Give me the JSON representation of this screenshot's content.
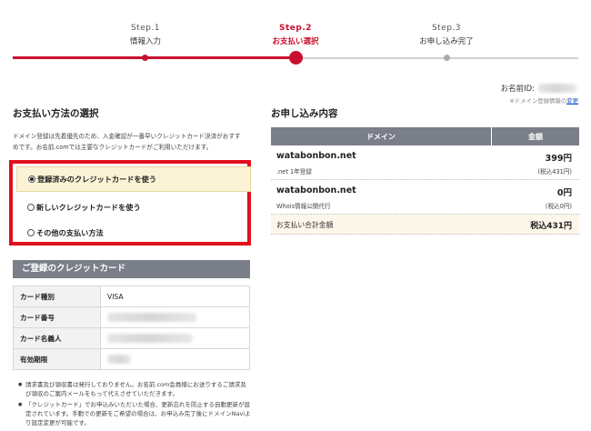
{
  "steps": [
    {
      "num": "Step.1",
      "label": "情報入力"
    },
    {
      "num": "Step.2",
      "label": "お支払い選択"
    },
    {
      "num": "Step.3",
      "label": "お申し込み完了"
    }
  ],
  "colors": {
    "accent": "#c8102e",
    "highlight_box": "#e0101c",
    "header_gray": "#7a7f89"
  },
  "payment": {
    "title": "お支払い方法の選択",
    "note_line1": "ドメイン登録は先着優先のため、入金確認が一番早いクレジットカード決済がおすす",
    "note_line2": "めです。お名前.comでは主要なクレジットカードがご利用いただけます。",
    "options": [
      {
        "label": "登録済みのクレジットカードを使う",
        "selected": true
      },
      {
        "label": "新しいクレジットカードを使う",
        "selected": false
      },
      {
        "label": "その他の支払い方法",
        "selected": false
      }
    ]
  },
  "card": {
    "title": "ご登録のクレジットカード",
    "rows": [
      {
        "key": "カード種別",
        "value": "VISA"
      },
      {
        "key": "カード番号",
        "value": ""
      },
      {
        "key": "カード名義人",
        "value": ""
      },
      {
        "key": "有効期限",
        "value": ""
      }
    ]
  },
  "bullets": [
    "請求書及び領収書は発行しておりません。お名前.com会員様にお送りするご請求及び領収のご案内メールをもって代えさせていただきます。",
    "「クレジットカード」でお申込みいただいた場合、更新忘れを防止する自動更新が設定されています。手動での更新をご希望の場合は、お申込み完了後にドメインNaviより設定変更が可能です。"
  ],
  "account": {
    "id_label": "お名前ID:",
    "note_text": "※ドメイン登録情報の",
    "note_link": "変更"
  },
  "order": {
    "title": "お申し込み内容",
    "col_domain": "ドメイン",
    "col_amount": "金額",
    "rows": [
      {
        "domain": "watabonbon.net",
        "sub": ".net 1年登録",
        "price": "399円",
        "tax": "(税込431円)"
      },
      {
        "domain": "watabonbon.net",
        "sub": "Whois情報公開代行",
        "price": "0円",
        "tax": "(税込0円)"
      }
    ],
    "total_label": "お支払い合計金額",
    "total_amount": "税込431円"
  }
}
